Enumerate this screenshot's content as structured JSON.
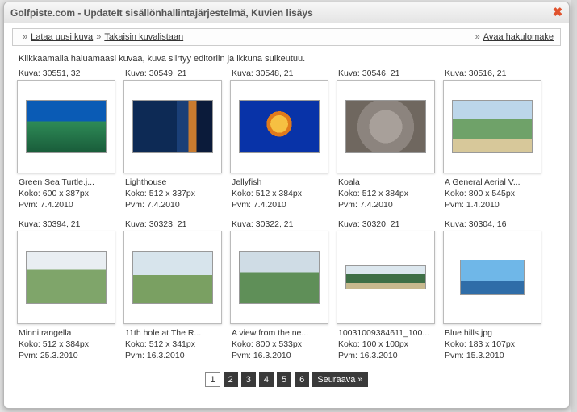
{
  "window": {
    "title": "Golfpiste.com - UpdateIt sisällönhallintajärjestelmä, Kuvien lisäys"
  },
  "toolbar": {
    "upload": "Lataa uusi kuva",
    "back": "Takaisin kuvalistaan",
    "search": "Avaa hakulomake",
    "sep": "»"
  },
  "instruction": "Klikkaamalla haluamaasi kuvaa, kuva siirtyy editoriin ja ikkuna sulkeutuu.",
  "labels": {
    "kuva": "Kuva:",
    "koko": "Koko:",
    "pvm": "Pvm:"
  },
  "images": [
    {
      "id": "30551, 32",
      "name": "Green Sea Turtle.j...",
      "size": "600 x 387px",
      "date": "7.4.2010",
      "cls": "t-turtle"
    },
    {
      "id": "30549, 21",
      "name": "Lighthouse",
      "size": "512 x 337px",
      "date": "7.4.2010",
      "cls": "t-lighthouse"
    },
    {
      "id": "30548, 21",
      "name": "Jellyfish",
      "size": "512 x 384px",
      "date": "7.4.2010",
      "cls": "t-jelly"
    },
    {
      "id": "30546, 21",
      "name": "Koala",
      "size": "512 x 384px",
      "date": "7.4.2010",
      "cls": "t-koala"
    },
    {
      "id": "30516, 21",
      "name": "A General Aerial V...",
      "size": "800 x 545px",
      "date": "1.4.2010",
      "cls": "t-aerial"
    },
    {
      "id": "30394, 21",
      "name": "Minni rangella",
      "size": "512 x 384px",
      "date": "25.3.2010",
      "cls": "t-range"
    },
    {
      "id": "30323, 21",
      "name": "11th hole at The R...",
      "size": "512 x 341px",
      "date": "16.3.2010",
      "cls": "t-11th"
    },
    {
      "id": "30322, 21",
      "name": "A view from the ne...",
      "size": "800 x 533px",
      "date": "16.3.2010",
      "cls": "t-view"
    },
    {
      "id": "30320, 21",
      "name": "10031009384611_100...",
      "size": "100 x 100px",
      "date": "16.3.2010",
      "cls": "t-num"
    },
    {
      "id": "30304, 16",
      "name": "Blue hills.jpg",
      "size": "183 x 107px",
      "date": "15.3.2010",
      "cls": "t-blue"
    }
  ],
  "pager": {
    "pages": [
      "1",
      "2",
      "3",
      "4",
      "5",
      "6"
    ],
    "current": "1",
    "next": "Seuraava »"
  }
}
